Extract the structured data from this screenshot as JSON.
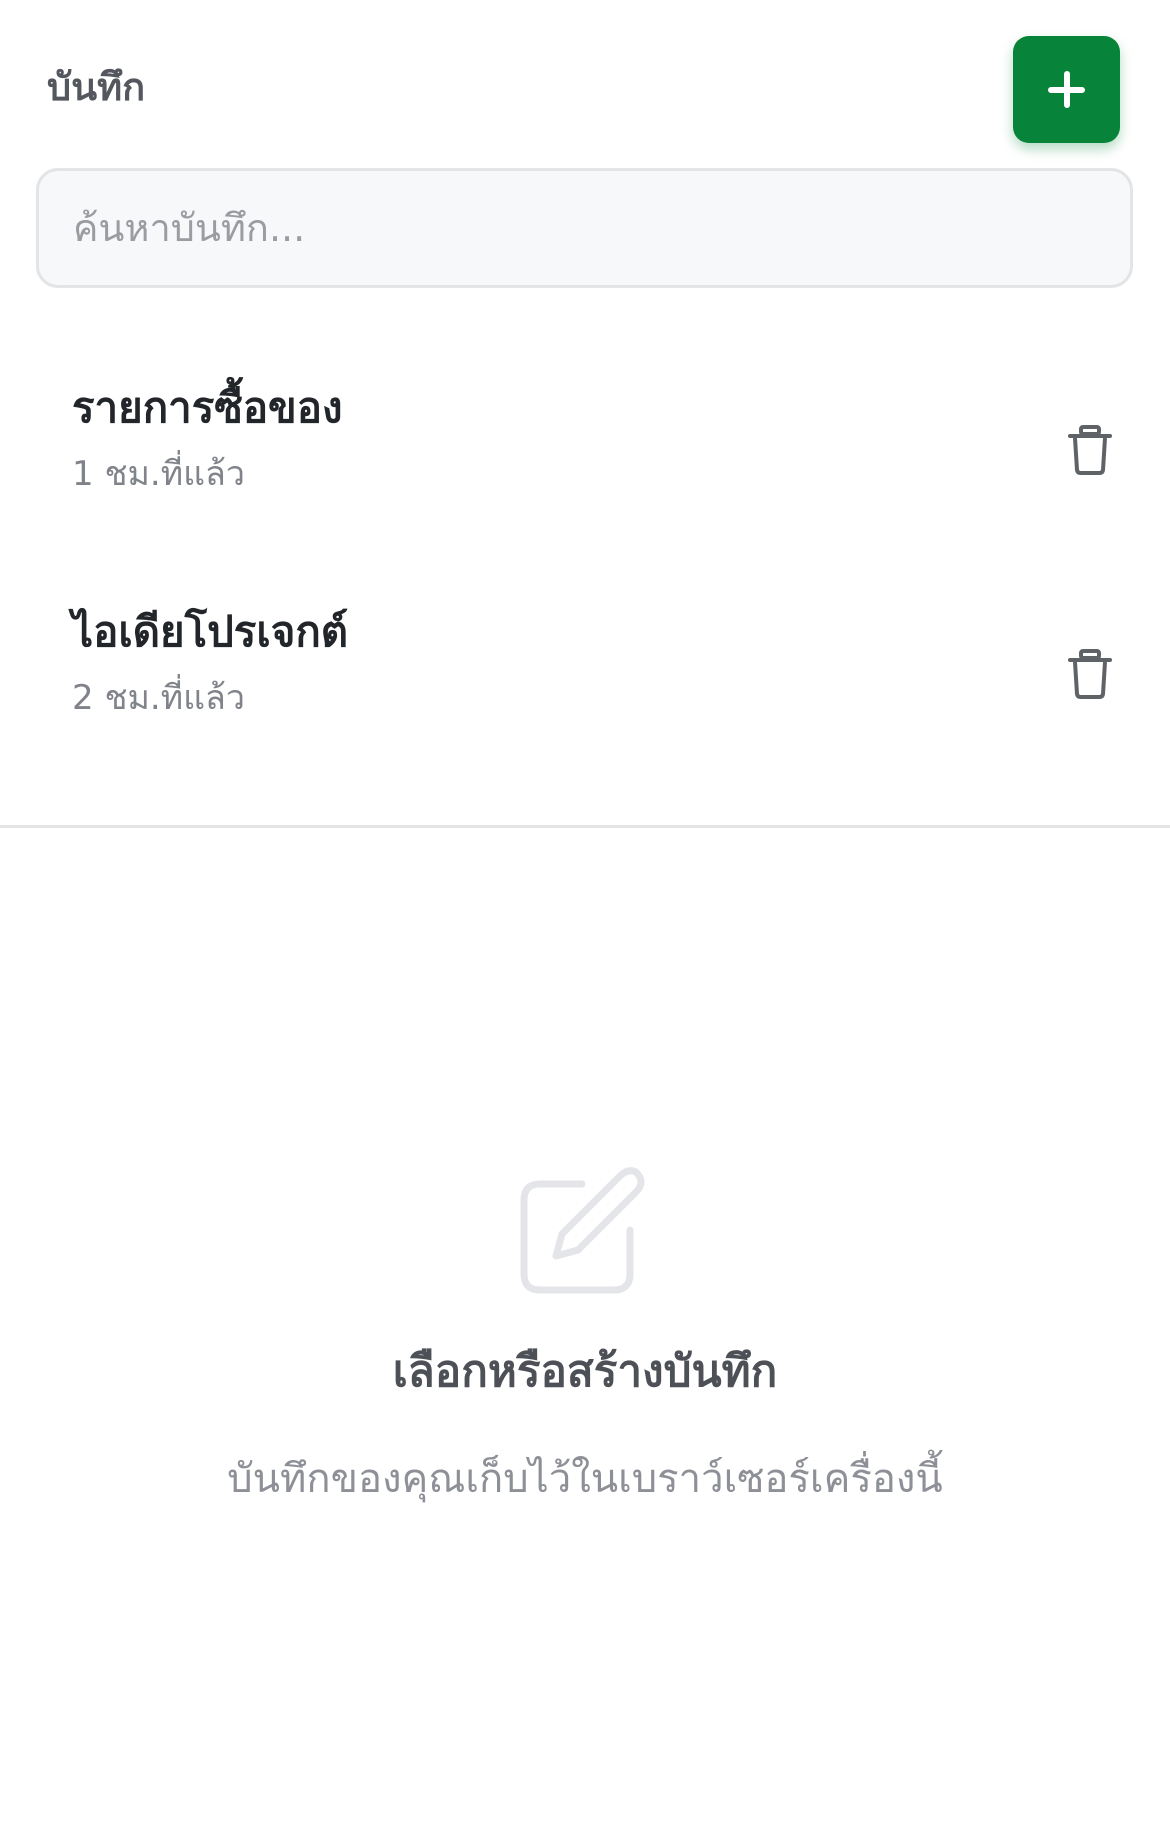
{
  "header": {
    "title": "บันทึก",
    "add_button_icon": "plus-icon",
    "accent_color": "#07833a"
  },
  "search": {
    "placeholder": "ค้นหาบันทึก...",
    "value": ""
  },
  "notes": [
    {
      "title": "รายการซื้อของ",
      "time": "1 ชม.ที่แล้ว",
      "delete_icon": "trash-icon"
    },
    {
      "title": "ไอเดียโปรเจกต์",
      "time": "2 ชม.ที่แล้ว",
      "delete_icon": "trash-icon"
    }
  ],
  "empty_state": {
    "icon": "edit-note-icon",
    "title": "เลือกหรือสร้างบันทึก",
    "description": "บันทึกของคุณเก็บไว้ในเบราว์เซอร์เครื่องนี้"
  }
}
